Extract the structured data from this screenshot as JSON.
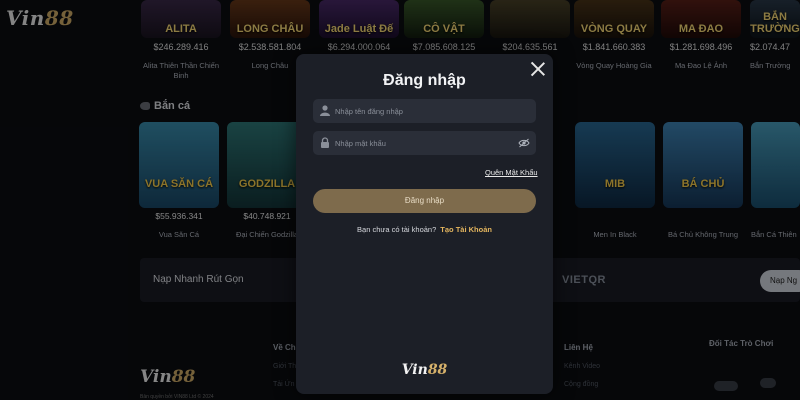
{
  "site": {
    "logo_text": "Vin",
    "logo_num": "88"
  },
  "slots": [
    {
      "tag": "ALITA",
      "jackpot": "$246.289.416",
      "name": "Alita Thiên Thần Chiến Binh",
      "color": "#3b2a4a"
    },
    {
      "tag": "LONG CHÂU",
      "jackpot": "$2.538.581.804",
      "name": "Long Châu",
      "color": "#5a2a18"
    },
    {
      "tag": "Jade Luật Đế",
      "jackpot": "$6.294.000.064",
      "name": "",
      "color": "#3b2258"
    },
    {
      "tag": "CÔ VẬT",
      "jackpot": "$7.085.608.125",
      "name": "",
      "color": "#2a4a2a"
    },
    {
      "tag": "",
      "jackpot": "$204.635.561",
      "name": "",
      "color": "#3a3520"
    },
    {
      "tag": "VÒNG QUAY",
      "jackpot": "$1.841.660.383",
      "name": "Vòng Quay Hoàng Gia",
      "color": "#3a2a14"
    },
    {
      "tag": "MA ĐAO",
      "jackpot": "$1.281.698.496",
      "name": "Ma Đao Lệ Ảnh",
      "color": "#4a1a14"
    },
    {
      "tag": "BẮN TRƯỜNG",
      "jackpot": "$2.074.47",
      "name": "Bắn Trường",
      "color": "#2a3a4a"
    }
  ],
  "fish_section": {
    "title": "Bắn cá"
  },
  "fish": [
    {
      "tag": "VUA SĂN CÁ",
      "jackpot": "$55.936.341",
      "name": "Vua Săn Cá",
      "color": "#2a6a8a"
    },
    {
      "tag": "GODZILLA",
      "jackpot": "$40.748.921",
      "name": "Đại Chiến Godzilla",
      "color": "#1f5a5a"
    },
    {
      "tag": "MIB",
      "jackpot": "",
      "name": "Men In Black",
      "color": "#1e4a6e"
    },
    {
      "tag": "BÁ CHỦ",
      "jackpot": "",
      "name": "Bá Chủ Không Trung",
      "color": "#2e5f86"
    },
    {
      "tag": "",
      "jackpot": "",
      "name": "Bắn Cá Thiên",
      "color": "#2f7a9a"
    }
  ],
  "deposit": {
    "title": "Nạp Nhanh Rút Gọn",
    "provider": "VIETQR",
    "button": "Nạp Ng"
  },
  "footer": {
    "small": "Bản quyền bởi VIN88 Ltd © 2024",
    "about_heading": "Về Ch",
    "about_links": [
      "Giới Th",
      "Tải Ứn"
    ],
    "contact_heading": "Liên Hệ",
    "contact_links": [
      "Kênh Video",
      "Cộng đồng"
    ],
    "partners_heading": "Đối Tác Trò Chơi"
  },
  "modal": {
    "title": "Đăng nhập",
    "username_placeholder": "Nhập tên đăng nhập",
    "password_placeholder": "Nhập mật khẩu",
    "forgot": "Quên Mật Khẩu",
    "login_button": "Đăng nhập",
    "no_account": "Bạn chưa có tài khoản?",
    "register": "Tạo Tài Khoản",
    "logo_text": "Vin",
    "logo_num": "88"
  }
}
